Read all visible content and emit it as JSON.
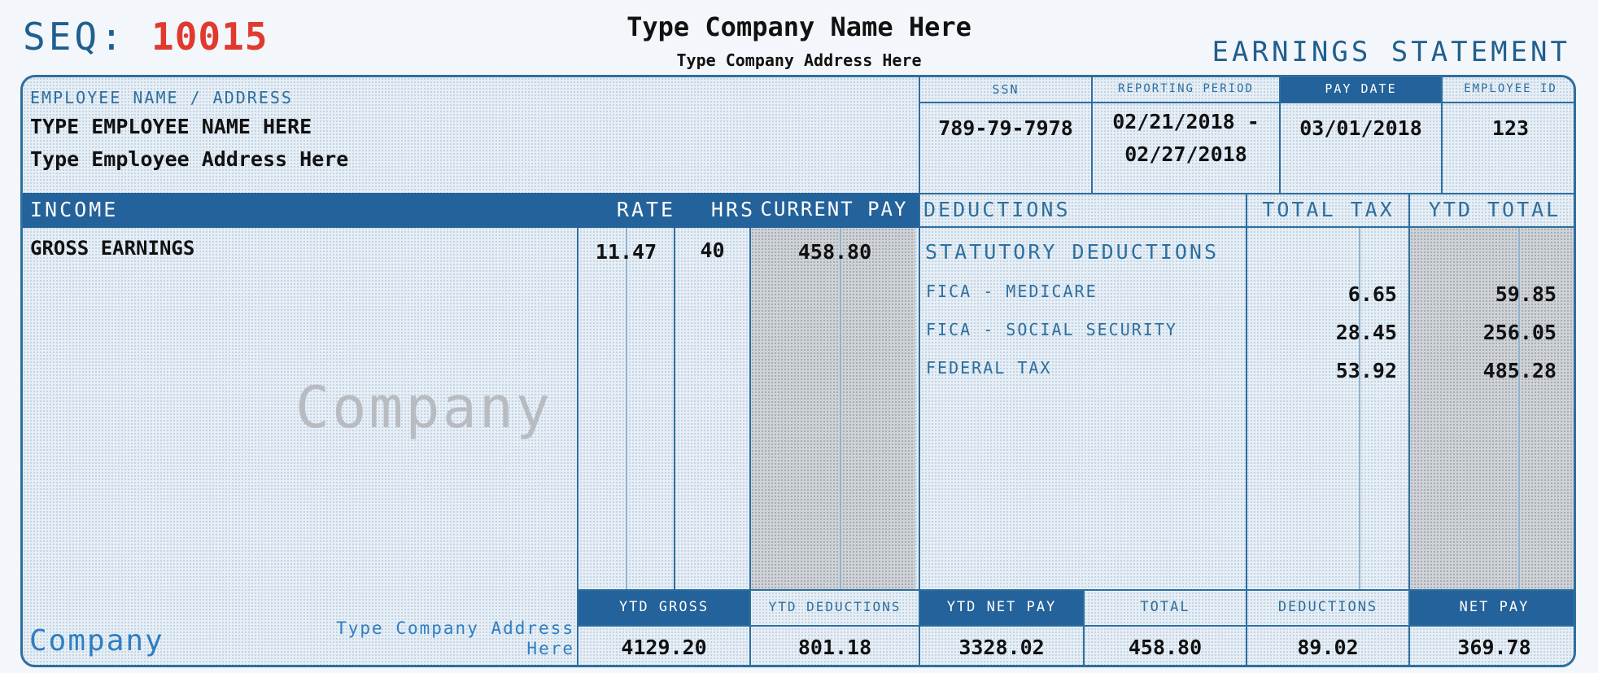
{
  "header": {
    "seq_label": "SEQ:",
    "seq_number": "10015",
    "company_name": "Type Company Name Here",
    "company_address": "Type Company Address Here",
    "statement_title": "EARNINGS STATEMENT"
  },
  "employee": {
    "section_label": "EMPLOYEE NAME / ADDRESS",
    "name": "TYPE EMPLOYEE NAME HERE",
    "address": "Type Employee Address Here"
  },
  "info": {
    "ssn_label": "SSN",
    "ssn": "789-79-7978",
    "period_label": "REPORTING PERIOD",
    "period_start": "02/21/2018 -",
    "period_end": "02/27/2018",
    "paydate_label": "PAY DATE",
    "paydate": "03/01/2018",
    "empid_label": "EMPLOYEE ID",
    "empid": "123"
  },
  "income": {
    "col_income": "INCOME",
    "col_rate": "RATE",
    "col_hrs": "HRS",
    "col_current": "CURRENT PAY",
    "rows": [
      {
        "label": "GROSS EARNINGS",
        "rate": "11.47",
        "hrs": "40",
        "current": "458.80"
      }
    ]
  },
  "deductions": {
    "col_deductions": "DEDUCTIONS",
    "col_total_tax": "TOTAL TAX",
    "col_ytd_total": "YTD TOTAL",
    "section_title": "STATUTORY DEDUCTIONS",
    "rows": [
      {
        "label": "FICA - MEDICARE",
        "tax": "6.65",
        "ytd": "59.85"
      },
      {
        "label": "FICA - SOCIAL SECURITY",
        "tax": "28.45",
        "ytd": "256.05"
      },
      {
        "label": "FEDERAL TAX",
        "tax": "53.92",
        "ytd": "485.28"
      }
    ]
  },
  "watermark": "Company",
  "footer": {
    "company": "Company",
    "address_line1": "Type Company Address",
    "address_line2": "Here",
    "ytd_gross_label": "YTD GROSS",
    "ytd_gross": "4129.20",
    "ytd_deductions_label": "YTD DEDUCTIONS",
    "ytd_deductions": "801.18",
    "ytd_net_label": "YTD NET PAY",
    "ytd_net": "3328.02",
    "total_label": "TOTAL",
    "total": "458.80",
    "deductions_label": "DEDUCTIONS",
    "deductions": "89.02",
    "net_label": "NET PAY",
    "net": "369.78"
  },
  "colors": {
    "accent": "#23629a",
    "seq_number": "#e03a2f",
    "paper": "#e6eef6"
  }
}
